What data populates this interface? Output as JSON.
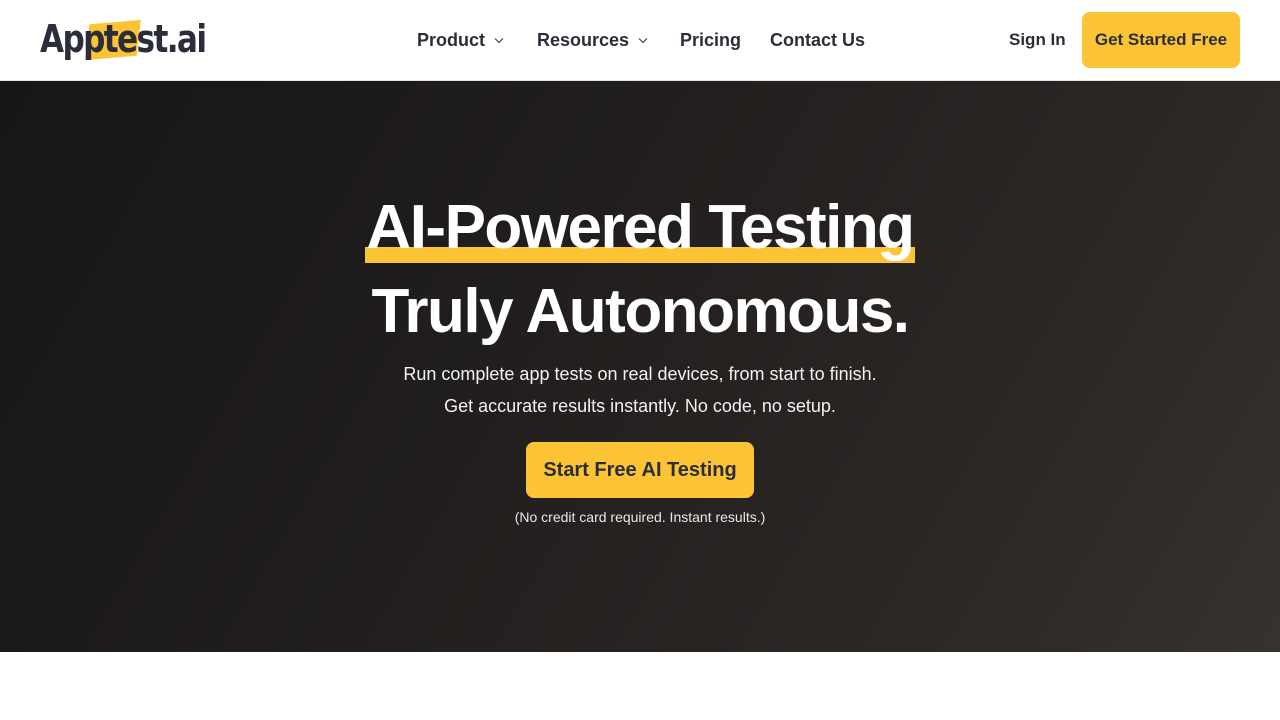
{
  "brand": {
    "logo_prefix": "App",
    "logo_highlight": "test",
    "logo_suffix": ".ai",
    "accent_color": "#fcc434",
    "text_color": "#2b2d3a"
  },
  "nav": {
    "items": [
      {
        "label": "Product",
        "has_dropdown": true
      },
      {
        "label": "Resources",
        "has_dropdown": true
      },
      {
        "label": "Pricing",
        "has_dropdown": false
      },
      {
        "label": "Contact Us",
        "has_dropdown": false
      }
    ],
    "sign_in_label": "Sign In",
    "cta_label": "Get Started Free"
  },
  "hero": {
    "headline_line1": "AI-Powered Testing",
    "headline_line2": "Truly Autonomous.",
    "subtext_line1": "Run complete app tests on real devices, from start to finish.",
    "subtext_line2": "Get accurate results instantly. No code, no setup.",
    "cta_label": "Start Free AI Testing",
    "note": "(No credit card required. Instant results.)"
  }
}
